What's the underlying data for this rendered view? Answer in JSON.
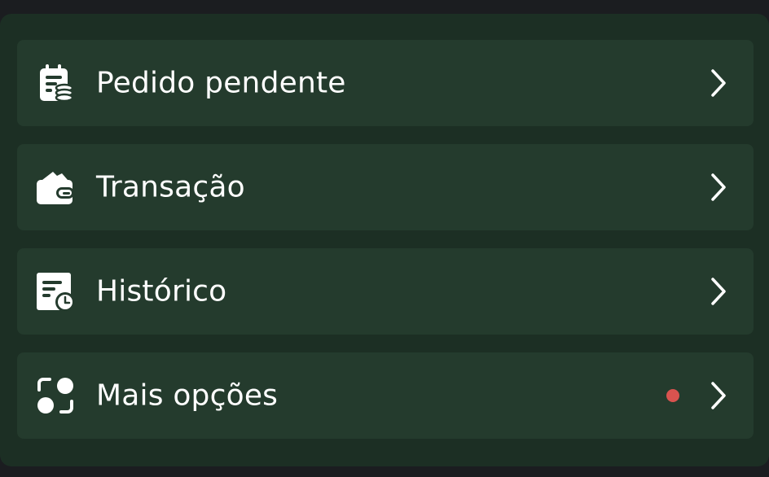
{
  "menu": {
    "items": [
      {
        "label": "Pedido pendente",
        "icon": "pending-order-icon"
      },
      {
        "label": "Transação",
        "icon": "wallet-icon"
      },
      {
        "label": "Histórico",
        "icon": "history-icon"
      },
      {
        "label": "Mais opções",
        "icon": "more-options-icon",
        "badge": "notification-dot"
      }
    ]
  },
  "colors": {
    "page_background": "#1b1d20",
    "panel_background": "#1c2f24",
    "item_background": "#243b2d",
    "text": "#ffffff",
    "badge": "#d9534f"
  }
}
